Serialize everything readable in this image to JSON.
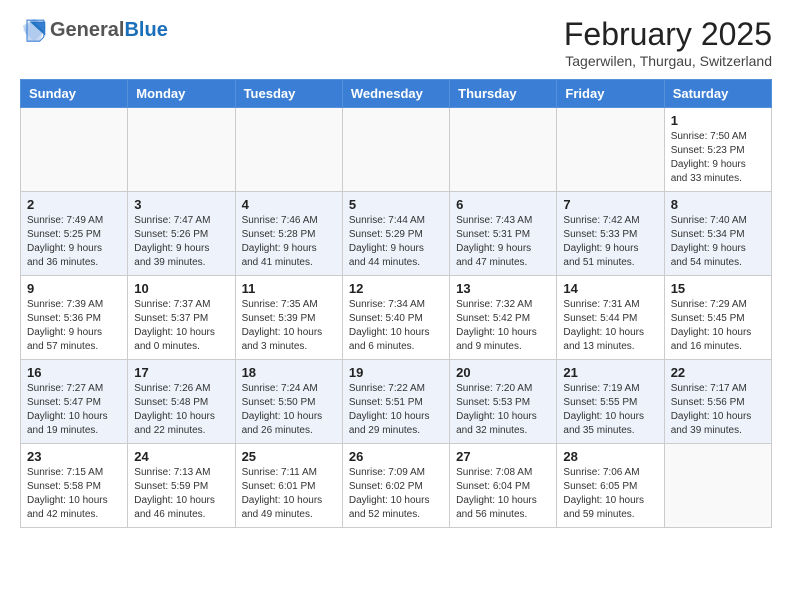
{
  "header": {
    "logo_general": "General",
    "logo_blue": "Blue",
    "month_year": "February 2025",
    "location": "Tagerwilen, Thurgau, Switzerland"
  },
  "days_of_week": [
    "Sunday",
    "Monday",
    "Tuesday",
    "Wednesday",
    "Thursday",
    "Friday",
    "Saturday"
  ],
  "weeks": [
    [
      {
        "day": "",
        "info": ""
      },
      {
        "day": "",
        "info": ""
      },
      {
        "day": "",
        "info": ""
      },
      {
        "day": "",
        "info": ""
      },
      {
        "day": "",
        "info": ""
      },
      {
        "day": "",
        "info": ""
      },
      {
        "day": "1",
        "info": "Sunrise: 7:50 AM\nSunset: 5:23 PM\nDaylight: 9 hours and 33 minutes."
      }
    ],
    [
      {
        "day": "2",
        "info": "Sunrise: 7:49 AM\nSunset: 5:25 PM\nDaylight: 9 hours and 36 minutes."
      },
      {
        "day": "3",
        "info": "Sunrise: 7:47 AM\nSunset: 5:26 PM\nDaylight: 9 hours and 39 minutes."
      },
      {
        "day": "4",
        "info": "Sunrise: 7:46 AM\nSunset: 5:28 PM\nDaylight: 9 hours and 41 minutes."
      },
      {
        "day": "5",
        "info": "Sunrise: 7:44 AM\nSunset: 5:29 PM\nDaylight: 9 hours and 44 minutes."
      },
      {
        "day": "6",
        "info": "Sunrise: 7:43 AM\nSunset: 5:31 PM\nDaylight: 9 hours and 47 minutes."
      },
      {
        "day": "7",
        "info": "Sunrise: 7:42 AM\nSunset: 5:33 PM\nDaylight: 9 hours and 51 minutes."
      },
      {
        "day": "8",
        "info": "Sunrise: 7:40 AM\nSunset: 5:34 PM\nDaylight: 9 hours and 54 minutes."
      }
    ],
    [
      {
        "day": "9",
        "info": "Sunrise: 7:39 AM\nSunset: 5:36 PM\nDaylight: 9 hours and 57 minutes."
      },
      {
        "day": "10",
        "info": "Sunrise: 7:37 AM\nSunset: 5:37 PM\nDaylight: 10 hours and 0 minutes."
      },
      {
        "day": "11",
        "info": "Sunrise: 7:35 AM\nSunset: 5:39 PM\nDaylight: 10 hours and 3 minutes."
      },
      {
        "day": "12",
        "info": "Sunrise: 7:34 AM\nSunset: 5:40 PM\nDaylight: 10 hours and 6 minutes."
      },
      {
        "day": "13",
        "info": "Sunrise: 7:32 AM\nSunset: 5:42 PM\nDaylight: 10 hours and 9 minutes."
      },
      {
        "day": "14",
        "info": "Sunrise: 7:31 AM\nSunset: 5:44 PM\nDaylight: 10 hours and 13 minutes."
      },
      {
        "day": "15",
        "info": "Sunrise: 7:29 AM\nSunset: 5:45 PM\nDaylight: 10 hours and 16 minutes."
      }
    ],
    [
      {
        "day": "16",
        "info": "Sunrise: 7:27 AM\nSunset: 5:47 PM\nDaylight: 10 hours and 19 minutes."
      },
      {
        "day": "17",
        "info": "Sunrise: 7:26 AM\nSunset: 5:48 PM\nDaylight: 10 hours and 22 minutes."
      },
      {
        "day": "18",
        "info": "Sunrise: 7:24 AM\nSunset: 5:50 PM\nDaylight: 10 hours and 26 minutes."
      },
      {
        "day": "19",
        "info": "Sunrise: 7:22 AM\nSunset: 5:51 PM\nDaylight: 10 hours and 29 minutes."
      },
      {
        "day": "20",
        "info": "Sunrise: 7:20 AM\nSunset: 5:53 PM\nDaylight: 10 hours and 32 minutes."
      },
      {
        "day": "21",
        "info": "Sunrise: 7:19 AM\nSunset: 5:55 PM\nDaylight: 10 hours and 35 minutes."
      },
      {
        "day": "22",
        "info": "Sunrise: 7:17 AM\nSunset: 5:56 PM\nDaylight: 10 hours and 39 minutes."
      }
    ],
    [
      {
        "day": "23",
        "info": "Sunrise: 7:15 AM\nSunset: 5:58 PM\nDaylight: 10 hours and 42 minutes."
      },
      {
        "day": "24",
        "info": "Sunrise: 7:13 AM\nSunset: 5:59 PM\nDaylight: 10 hours and 46 minutes."
      },
      {
        "day": "25",
        "info": "Sunrise: 7:11 AM\nSunset: 6:01 PM\nDaylight: 10 hours and 49 minutes."
      },
      {
        "day": "26",
        "info": "Sunrise: 7:09 AM\nSunset: 6:02 PM\nDaylight: 10 hours and 52 minutes."
      },
      {
        "day": "27",
        "info": "Sunrise: 7:08 AM\nSunset: 6:04 PM\nDaylight: 10 hours and 56 minutes."
      },
      {
        "day": "28",
        "info": "Sunrise: 7:06 AM\nSunset: 6:05 PM\nDaylight: 10 hours and 59 minutes."
      },
      {
        "day": "",
        "info": ""
      }
    ]
  ]
}
